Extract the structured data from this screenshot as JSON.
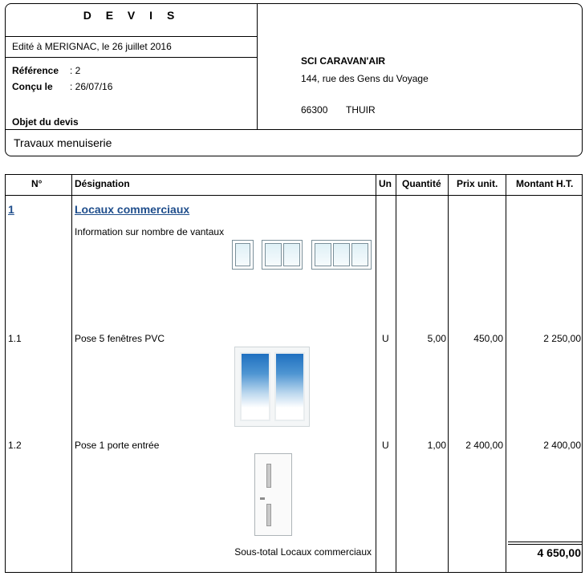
{
  "header": {
    "title": "D E V I S",
    "edited": "Edité à MERIGNAC, le 26 juillet 2016",
    "reference_label": "Référence",
    "reference_value": ": 2",
    "concu_label": "Conçu le",
    "concu_value": ":  26/07/16",
    "objet_label": "Objet du devis",
    "objet_text": "Travaux menuiserie"
  },
  "client": {
    "name": "SCI CARAVAN'AIR",
    "street": "144, rue des Gens du Voyage",
    "postcode": "66300",
    "city": "THUIR"
  },
  "table": {
    "headers": {
      "num": "N°",
      "designation": "Désignation",
      "unit": "Un",
      "quantity": "Quantité",
      "price": "Prix unit.",
      "amount": "Montant H.T."
    },
    "section": {
      "number": "1",
      "title": "Locaux commerciaux",
      "info": "Information sur nombre de vantaux"
    },
    "rows": [
      {
        "num": "1.1",
        "designation": "Pose 5 fenêtres PVC",
        "unit": "U",
        "quantity": "5,00",
        "price": "450,00",
        "amount": "2 250,00"
      },
      {
        "num": "1.2",
        "designation": "Pose 1 porte entrée",
        "unit": "U",
        "quantity": "1,00",
        "price": "2 400,00",
        "amount": "2 400,00"
      }
    ],
    "subtotal_label": "Sous-total  Locaux commerciaux",
    "subtotal_value": "4 650,00"
  }
}
